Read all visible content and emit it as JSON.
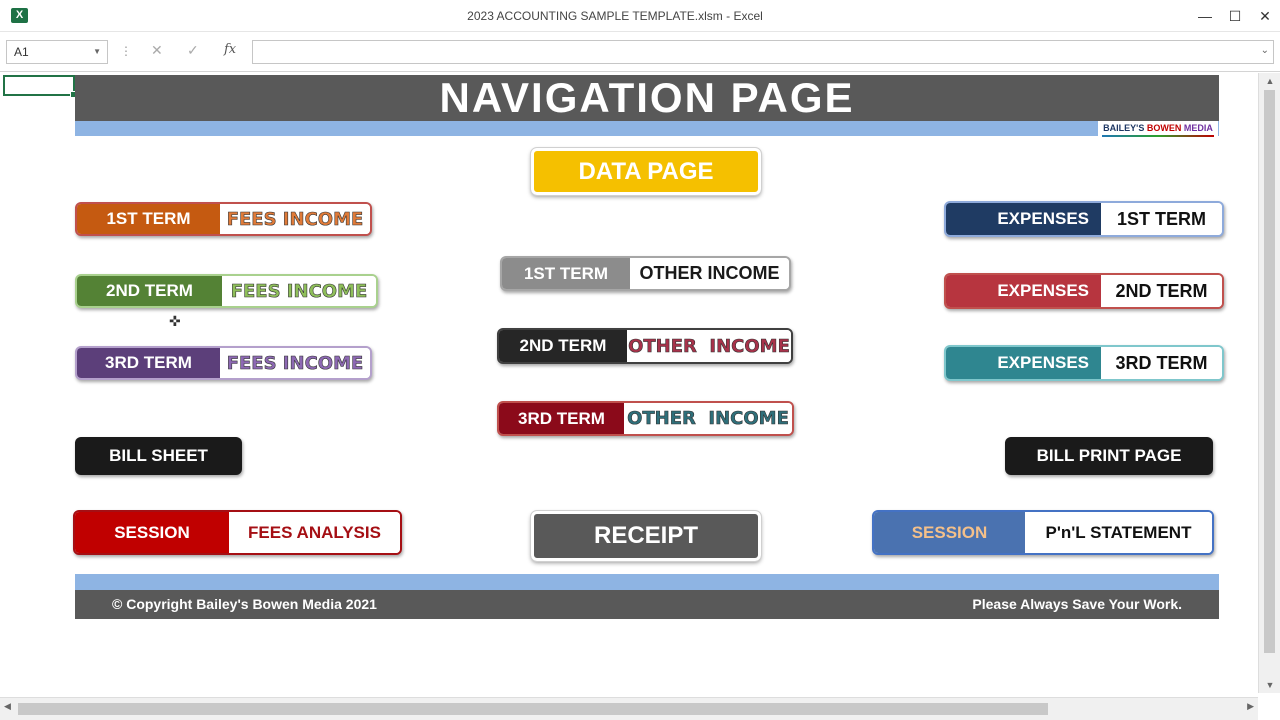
{
  "window": {
    "title": "2023 ACCOUNTING SAMPLE TEMPLATE.xlsm - Excel",
    "app_icon": "X",
    "controls": {
      "minimize": "—",
      "maximize": "☐",
      "close": "✕"
    }
  },
  "formula_bar": {
    "name_box": "A1",
    "cancel_icon": "✕",
    "enter_icon": "✓",
    "fx_label": "fx",
    "formula": ""
  },
  "sheet": {
    "header_title": "NAVIGATION PAGE",
    "logo": {
      "part1": "BAILEY'S ",
      "part2": "BOWEN ",
      "part3": "MEDIA"
    },
    "data_page": "DATA PAGE",
    "fees": [
      {
        "term": "1ST TERM",
        "label": "FEES INCOME",
        "color": "#c55a11",
        "text_color": "#e07b39"
      },
      {
        "term": "2ND TERM",
        "label": "FEES INCOME",
        "color": "#548235",
        "text_color": "#8fbf5a"
      },
      {
        "term": "3RD TERM",
        "label": "FEES INCOME",
        "color": "#5c3f7a",
        "text_color": "#8d69b3"
      }
    ],
    "other_income": [
      {
        "term": "1ST TERM",
        "label": "OTHER INCOME",
        "color": "#8c8c8c",
        "text_color": "#1a1a1a"
      },
      {
        "term": "2ND TERM",
        "label": "OTHER  INCOME",
        "color": "#262626",
        "text_color": "#a8324a"
      },
      {
        "term": "3RD TERM",
        "label": "OTHER  INCOME",
        "color": "#8b0a1a",
        "text_color": "#2f6f7a"
      }
    ],
    "expenses": [
      {
        "label": "EXPENSES",
        "term": "1ST TERM",
        "color": "#1f3b63"
      },
      {
        "label": "EXPENSES",
        "term": "2ND TERM",
        "color": "#b7353f"
      },
      {
        "label": "EXPENSES",
        "term": "3RD TERM",
        "color": "#2f8690"
      }
    ],
    "bill_sheet": "BILL SHEET",
    "bill_print": "BILL PRINT PAGE",
    "session_fees": {
      "left": "SESSION",
      "right": "FEES ANALYSIS"
    },
    "receipt": "RECEIPT",
    "session_pnl": {
      "left": "SESSION",
      "right": "P'n'L STATEMENT"
    },
    "footer_left": "© Copyright Bailey's Bowen Media 2021",
    "footer_right": "Please Always Save Your Work."
  }
}
